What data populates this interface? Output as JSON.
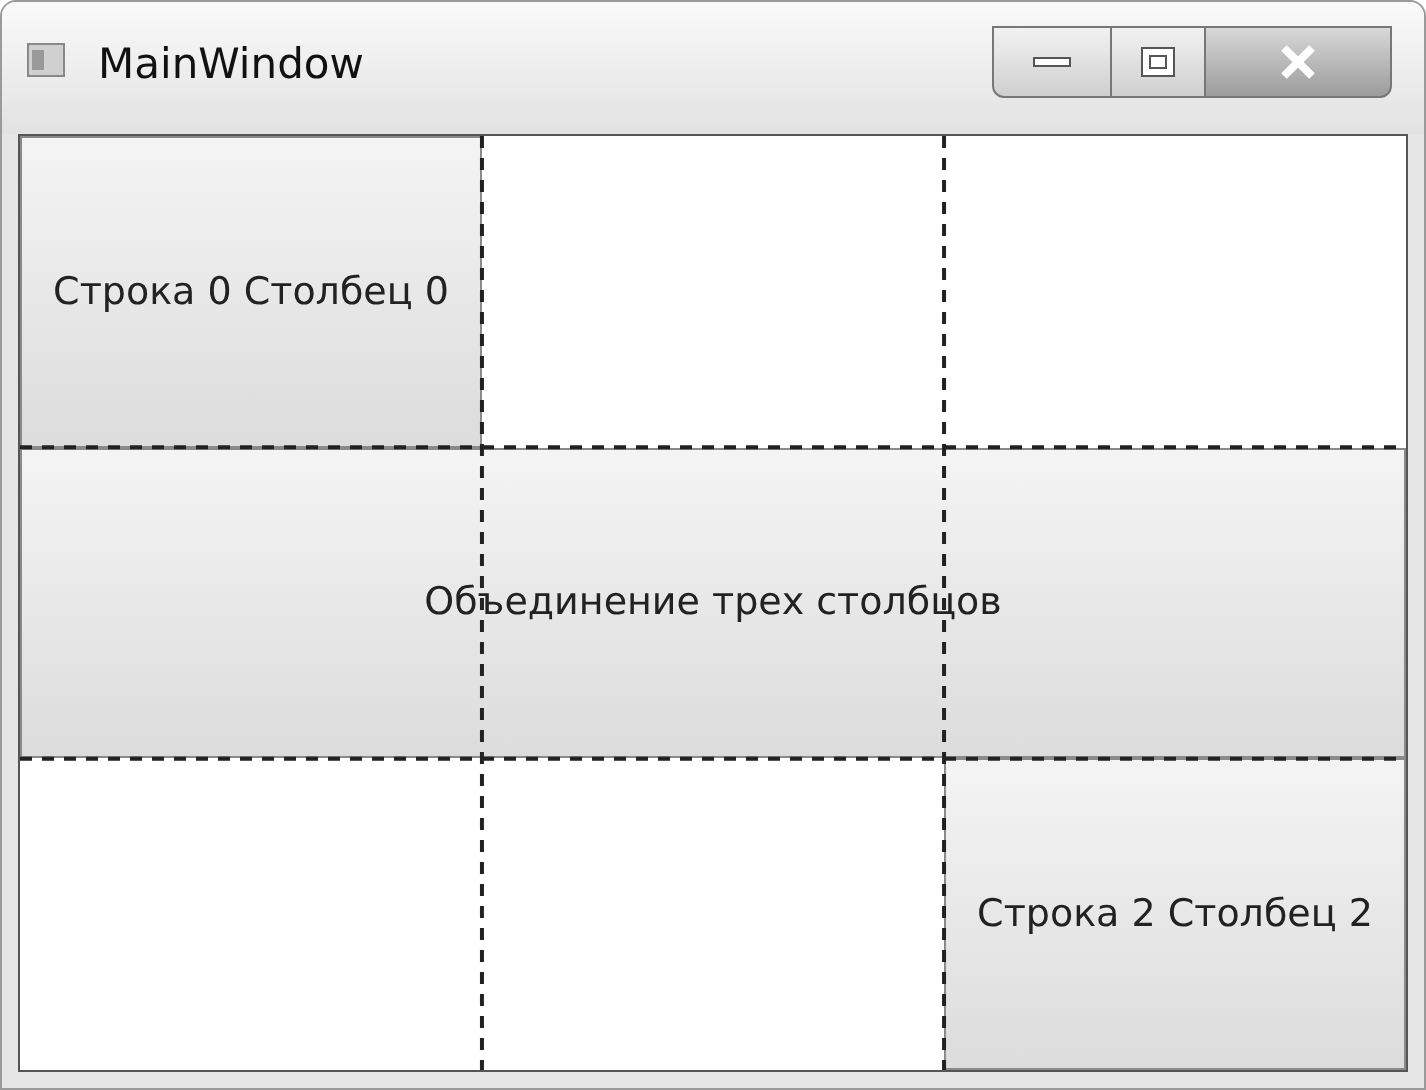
{
  "window": {
    "title": "MainWindow"
  },
  "grid": {
    "rows": [
      {
        "cells": [
          {
            "kind": "button",
            "label": "Строка 0 Столбец 0"
          },
          {
            "kind": "empty"
          },
          {
            "kind": "empty"
          }
        ]
      },
      {
        "cells": [
          {
            "kind": "wide-button",
            "label": "Объединение трех столбцов"
          }
        ]
      },
      {
        "cells": [
          {
            "kind": "empty"
          },
          {
            "kind": "empty"
          },
          {
            "kind": "button",
            "label": "Строка 2 Столбец 2"
          }
        ]
      }
    ]
  }
}
